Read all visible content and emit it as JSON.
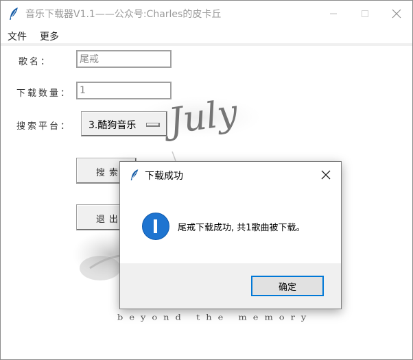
{
  "window": {
    "title": "音乐下载器V1.1——公众号:Charles的皮卡丘",
    "controls": {
      "minimize_icon": "minimize-icon",
      "maximize_icon": "maximize-icon",
      "close_icon": "close-icon"
    }
  },
  "menu": {
    "items": [
      {
        "label": "文件"
      },
      {
        "label": "更多"
      }
    ]
  },
  "form": {
    "song_label": "歌名：",
    "song_value": "尾戒",
    "count_label": "下载数量：",
    "count_value": "1",
    "platform_label": "搜索平台：",
    "platform_value": "3.酷狗音乐"
  },
  "buttons": {
    "search": "搜索",
    "exit": "退出"
  },
  "background": {
    "art_title": "July",
    "caption": "beyond the memory"
  },
  "dialog": {
    "title": "下载成功",
    "message": "尾戒下载成功, 共1歌曲被下载。",
    "ok_label": "确定",
    "icon": "info-icon",
    "accent": "#0078d7"
  }
}
